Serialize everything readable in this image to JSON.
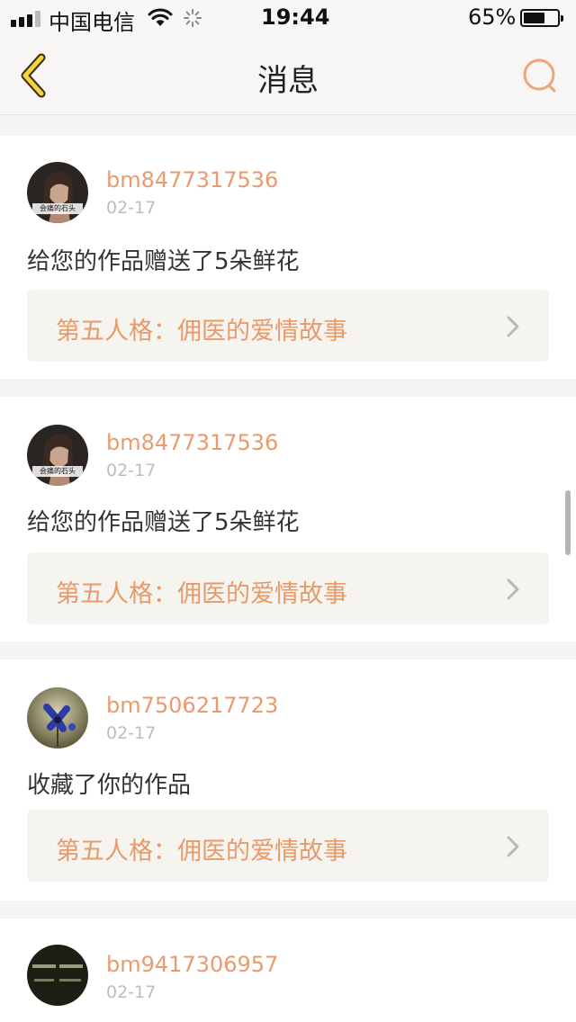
{
  "status_bar": {
    "carrier": "中国电信",
    "time": "19:44",
    "battery_percent": "65%",
    "battery_level": 0.65
  },
  "nav": {
    "title": "消息",
    "back_icon": "chevron-left-icon",
    "search_icon": "search-icon"
  },
  "colors": {
    "accent": "#ea9a6c",
    "link_bg": "#f5f4ee",
    "back_icon_fill": "#f2d53c"
  },
  "messages": [
    {
      "username": "bm8477317536",
      "date": "02-17",
      "text": "给您的作品赠送了5朵鲜花",
      "work_title": "第五人格：佣医的爱情故事",
      "avatar_caption": "会痛的石头"
    },
    {
      "username": "bm8477317536",
      "date": "02-17",
      "text": "给您的作品赠送了5朵鲜花",
      "work_title": "第五人格：佣医的爱情故事",
      "avatar_caption": "会痛的石头"
    },
    {
      "username": "bm7506217723",
      "date": "02-17",
      "text": "收藏了你的作品",
      "work_title": "第五人格：佣医的爱情故事",
      "avatar_caption": ""
    },
    {
      "username": "bm9417306957",
      "date": "02-17",
      "text": "",
      "work_title": "",
      "avatar_caption": ""
    }
  ]
}
